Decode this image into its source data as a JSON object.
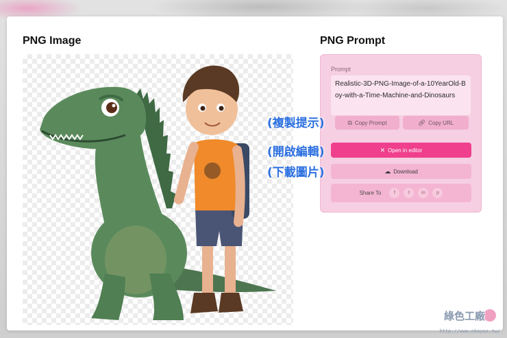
{
  "left_heading": "PNG Image",
  "right_heading": "PNG Prompt",
  "prompt": {
    "label": "Prompt",
    "text": "Realistic-3D-PNG-Image-of-a-10YearOld-Boy-with-a-Time-Machine-and-Dinosaurs"
  },
  "buttons": {
    "copy_prompt": "Copy Prompt",
    "copy_url": "Copy URL",
    "open_editor": "Open in editor",
    "download": "Download"
  },
  "share": {
    "label": "Share To",
    "networks": [
      "f",
      "t",
      "in",
      "p"
    ]
  },
  "annotations": {
    "copy": "(複製提示)",
    "edit": "(開啟編輯)",
    "download": "(下載圖片)"
  },
  "watermark": {
    "title": "綠色工廠",
    "url": "http://www.nkoyoz.tw/"
  },
  "colors": {
    "accent": "#ef3f8d",
    "panel": "#f6cfe2",
    "annotation": "#2b6fe0"
  },
  "icons": {
    "copy": "copy-icon",
    "link": "link-icon",
    "editor": "magic-wand-icon",
    "download": "cloud-download-icon"
  }
}
